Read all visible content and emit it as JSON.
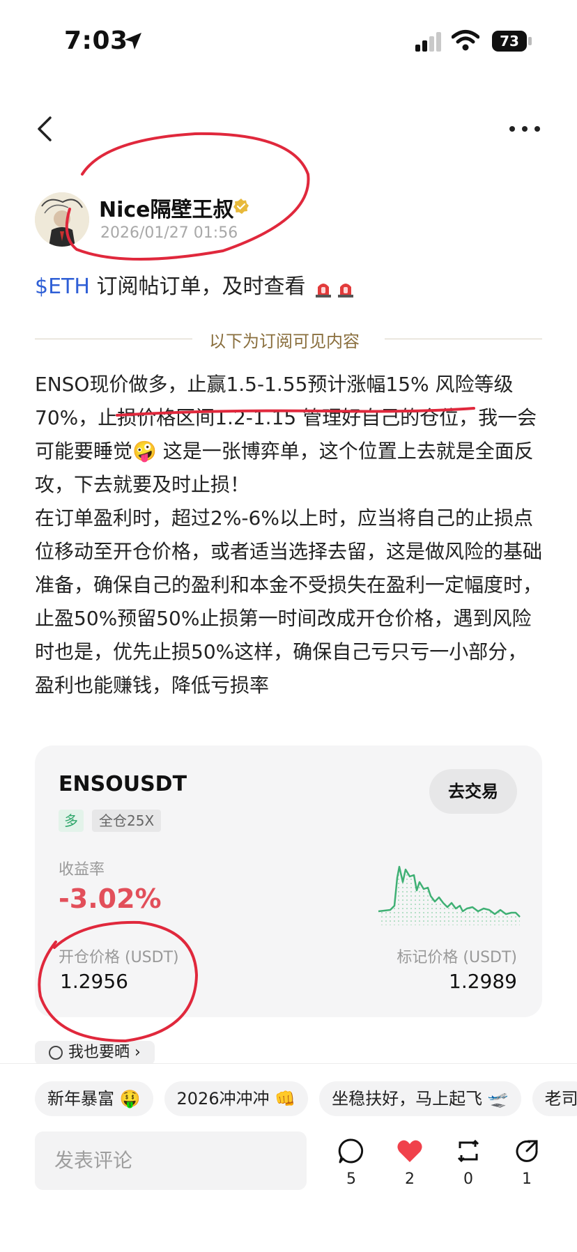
{
  "status_bar": {
    "time": "7:03",
    "battery": "73"
  },
  "post": {
    "author": "Nice隔壁王叔",
    "timestamp": "2026/01/27 01:56",
    "headline_tag": "$ETH",
    "headline_text": "订阅帖订单，及时查看",
    "divider": "以下为订阅可见内容",
    "paragraph1_a": "ENSO现价做多，止赢1.5-1.55预计涨幅15% 风险等级70%，止损价格区间1.2-1.15 管理好自己的仓位，我一会可能要睡觉",
    "paragraph1_b": " 这是一张博弈单，这个位置上去就是全面反攻，下去就要及时止损！",
    "paragraph2": "在订单盈利时，超过2%-6%以上时，应当将自己的止损点位移动至开仓价格，或者适当选择去留，这是做风险的基础准备，确保自己的盈利和本金不受损失在盈利一定幅度时，止盈50%预留50%止损第一时间改成开仓价格，遇到风险时也是，优先止损50%这样，确保自己亏只亏一小部分，盈利也能赚钱，降低亏损率"
  },
  "card": {
    "symbol": "ENSOUSDT",
    "trade_button": "去交易",
    "side": "多",
    "leverage": "全仓25X",
    "roi_label": "收益率",
    "roi_value": "-3.02%",
    "open_price_label": "开仓价格 (USDT)",
    "open_price": "1.2956",
    "mark_price_label": "标记价格 (USDT)",
    "mark_price": "1.2989",
    "also_share": "我也要晒"
  },
  "quick_replies": [
    "新年暴富 🤑",
    "2026冲冲冲 👊",
    "坐稳扶好，马上起飞 🛫",
    "老司"
  ],
  "comment_placeholder": "发表评论",
  "actions": {
    "comments": "5",
    "likes": "2",
    "reposts": "0",
    "shares": "1"
  },
  "colors": {
    "accent_red": "#e24f5a",
    "long_green": "#2ea66a",
    "tag_blue": "#2f5fd6",
    "annotation_red": "#e0283c"
  },
  "icons": [
    "location-arrow-icon",
    "signal-icon",
    "wifi-icon",
    "back-icon",
    "more-icon",
    "verified-icon",
    "siren-icon",
    "comment-icon",
    "heart-icon",
    "repost-icon",
    "share-icon"
  ]
}
